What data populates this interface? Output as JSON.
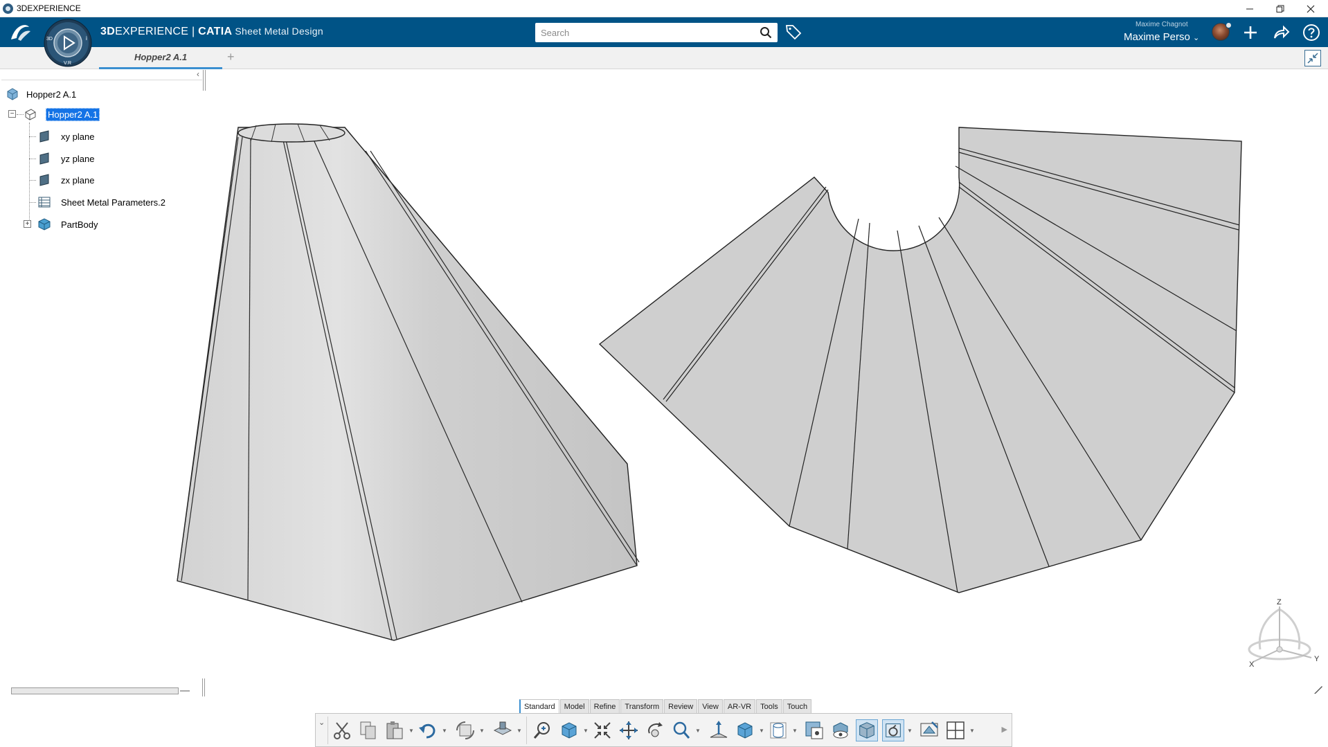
{
  "window": {
    "title": "3DEXPERIENCE",
    "controls": [
      "minimize",
      "restore",
      "close"
    ]
  },
  "topbar": {
    "brand_part1": "3D",
    "brand_part2": "EXPERIENCE | ",
    "brand_part3": "CATIA",
    "brand_part4": "Sheet Metal Design",
    "compass_label_left": "3D",
    "compass_label_bottom": "V.R",
    "compass_label_right": "i",
    "search_placeholder": "Search",
    "user_display_name": "Maxime Chagnot",
    "user_short": "Maxime Perso",
    "brand_color": "#005386"
  },
  "tabs": {
    "active": "Hopper2 A.1",
    "add": "+"
  },
  "tree": {
    "root": "Hopper2 A.1",
    "part": "Hopper2 A.1",
    "items": [
      {
        "label": "xy plane",
        "icon": "plane-icon"
      },
      {
        "label": "yz plane",
        "icon": "plane-icon"
      },
      {
        "label": "zx plane",
        "icon": "plane-icon"
      },
      {
        "label": "Sheet Metal Parameters.2",
        "icon": "parameters-icon"
      },
      {
        "label": "PartBody",
        "icon": "body-icon"
      }
    ],
    "collapse_label": "‹"
  },
  "action_bar": {
    "sections": [
      "Standard",
      "Model",
      "Refine",
      "Transform",
      "Review",
      "View",
      "AR-VR",
      "Tools",
      "Touch"
    ],
    "active_section": "Standard",
    "tools": [
      "cut-icon",
      "copy-icon",
      "paste-icon",
      "undo-icon",
      "update-icon",
      "snap-icon",
      "zoom-area-icon",
      "fit-all-icon",
      "pan-icon",
      "rotate-icon",
      "zoom-icon",
      "normal-view-icon",
      "view-cube-icon",
      "shading-icon",
      "hide-show-icon",
      "swap-visible-icon",
      "render-icon",
      "activity-icon",
      "display-mode-icon",
      "layout-icon"
    ]
  },
  "compass_triad": {
    "z": "Z",
    "x": "X",
    "y": "Y"
  }
}
